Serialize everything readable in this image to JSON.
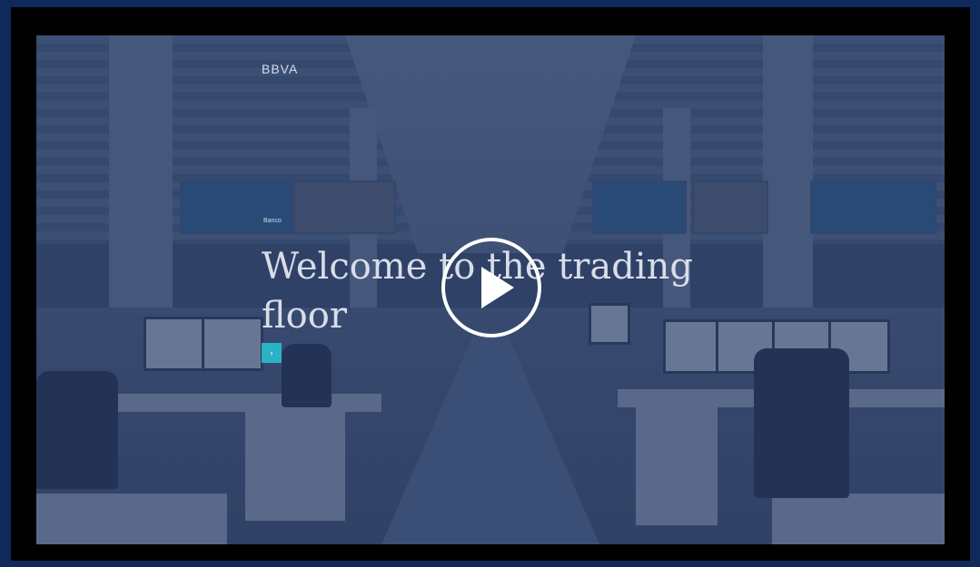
{
  "video": {
    "brand_logo": "BBVA",
    "screen_label": "Banco",
    "headline": "Welcome to the trading floor",
    "button_label": "›",
    "play_icon": "play-icon"
  },
  "colors": {
    "page_background": "#0f2a5a",
    "frame": "#000000",
    "accent_teal": "#2ab3c4",
    "overlay": "#263a64"
  }
}
